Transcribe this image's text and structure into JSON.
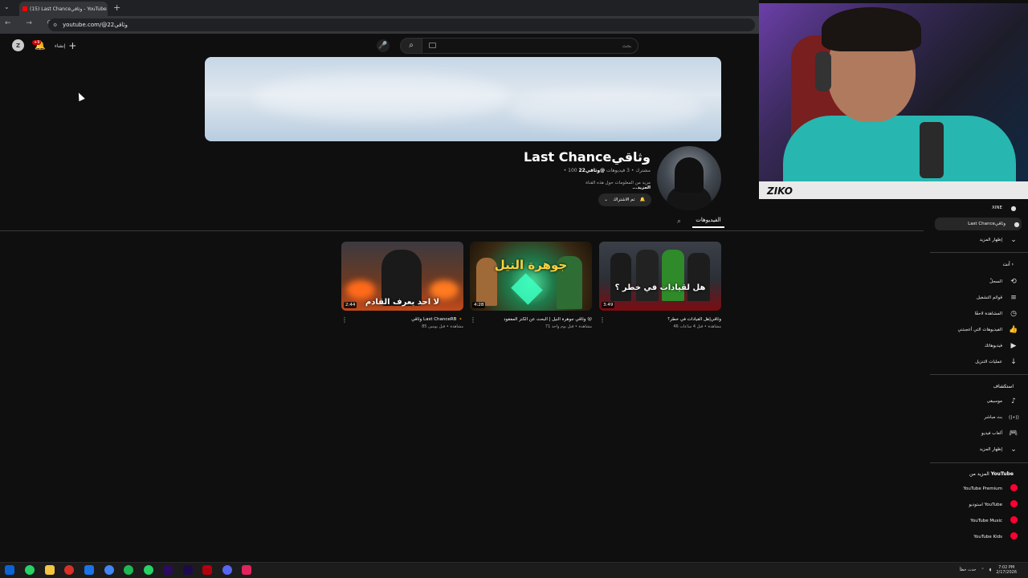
{
  "browser": {
    "tab_title": "(15) Last Chanceوثاقي - YouTube",
    "tab_close": "×",
    "new_tab": "+",
    "tab_menu": "⌄",
    "nav_buttons": "← → ⟳",
    "url": "youtube.com/@وثاقي22",
    "lock": "⚙"
  },
  "topbar": {
    "avatar_letter": "Z",
    "notif_icon": "🔔",
    "notif_badge": "+9",
    "create_label": "إنشاء",
    "create_plus": "+",
    "mic_icon": "🎤",
    "search_icon": "⌕",
    "search_placeholder": "بحث"
  },
  "channel": {
    "name": "Last Chanceوثاقي",
    "handle": "@وثاقي22",
    "meta_rest": " • 100 مشترك • 3 فيديوهات",
    "description": "مزيد من المعلومات حول هذه القناة",
    "more": "...المزيد",
    "subscribe_label": "تم الاشتراك",
    "bell_icon": "🔔",
    "chevron_icon": "⌄"
  },
  "tabs": {
    "videos": "الفيديوهات",
    "search_icon": "⌕"
  },
  "videos": [
    {
      "duration": "3:49",
      "thumb_text": "هل لقيادات في خطر ؟",
      "title": "وثاقي|هل القيادات في خطر؟",
      "meta": "46 مشاهدة • قبل 4 ساعات",
      "menu": "⋮"
    },
    {
      "duration": "4:28",
      "thumb_text": "جوهرة النيل",
      "title": "وثاقي جوهرة النيل | البحث عن الكنز المفقود 😮",
      "meta": "71 مشاهدة • قبل يوم واحد",
      "menu": "⋮"
    },
    {
      "duration": "2:44",
      "thumb_text": "لا احد يعرف القادم",
      "title": "وثاقي Last ChanceRB 🔸",
      "meta": "85 مشاهدة • قبل يومين",
      "menu": "⋮"
    }
  ],
  "sidebar": {
    "sub1": "XINE",
    "sub2": "Last Chanceوثاقي",
    "show_more": "إظهار المزيد",
    "you_section": "أنت ›",
    "you_items": [
      {
        "label": "السجلّ",
        "icon": "⟲"
      },
      {
        "label": "قوائم التشغيل",
        "icon": "≡"
      },
      {
        "label": "المشاهدة لاحقًا",
        "icon": "◷"
      },
      {
        "label": "الفيديوهات التي أعجبتني",
        "icon": "👍"
      },
      {
        "label": "فيديوهاتك",
        "icon": "▶"
      },
      {
        "label": "عمليات التنزيل",
        "icon": "↓"
      }
    ],
    "explore_section": "استكشاف",
    "explore_items": [
      {
        "label": "موسيقى",
        "icon": "♪"
      },
      {
        "label": "بث مباشر",
        "icon": "((•))"
      },
      {
        "label": "ألعاب فيديو",
        "icon": "🎮"
      },
      {
        "label": "إظهار المزيد",
        "icon": "⌄"
      }
    ],
    "more_from": "المزيد من",
    "youtube": "YouTube",
    "yt_apps": [
      "YouTube Premium",
      "استوديو YouTube",
      "YouTube Music",
      "YouTube Kids"
    ]
  },
  "taskbar": {
    "tray_text": "حدث خطأ",
    "time": "7:02 PM",
    "date": "2/17/2026"
  },
  "cam": {
    "logo": "ZIKO"
  },
  "colors": {
    "yt_red": "#ff0033",
    "bg": "#0f0f0f"
  }
}
